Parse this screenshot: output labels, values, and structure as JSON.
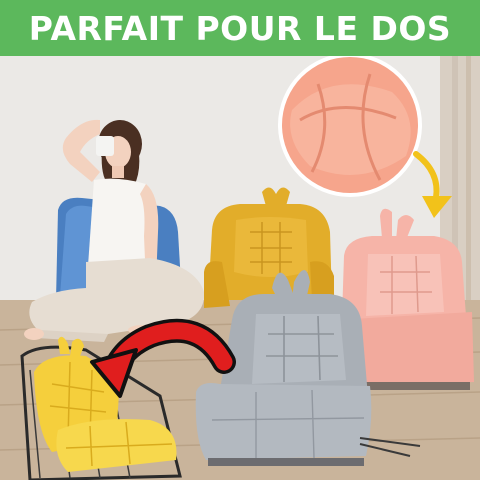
{
  "banner": {
    "text": "PARFAIT POUR LE DOS",
    "background_color": "#5cb85c",
    "text_color": "#ffffff"
  },
  "scene": {
    "cushion_colors": {
      "blue": "#4a7fc1",
      "yellow": "#e2ad2a",
      "peach": "#f6b4a8",
      "gray": "#a9afb6",
      "bright_yellow": "#f5cf3c"
    },
    "callout_arrow_color": "#f2c21a",
    "hand_arrow_color": "#e01e1e"
  }
}
